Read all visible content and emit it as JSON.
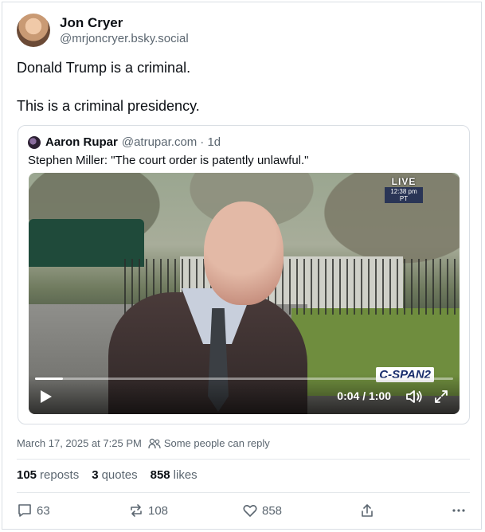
{
  "author": {
    "display_name": "Jon Cryer",
    "handle": "@mrjoncryer.bsky.social"
  },
  "post": {
    "lines": [
      "Donald Trump is a criminal.",
      "This is a criminal presidency."
    ]
  },
  "quoted_post": {
    "author_name": "Aaron Rupar",
    "author_handle": "@atrupar.com",
    "age": "· 1d",
    "text": "Stephen Miller: \"The court order is patently unlawful.\"",
    "video": {
      "live_label": "LIVE",
      "live_time": "12:38 pm PT",
      "network_logo": "C-SPAN2",
      "time_display": "0:04 / 1:00",
      "progress": 0.067,
      "icons": [
        "play-icon",
        "volume-icon",
        "fullscreen-icon"
      ]
    }
  },
  "meta": {
    "timestamp": "March 17, 2025 at 7:25 PM",
    "reply_setting": "Some people can reply"
  },
  "stats": [
    {
      "count": "105",
      "label": "reposts"
    },
    {
      "count": "3",
      "label": "quotes"
    },
    {
      "count": "858",
      "label": "likes"
    }
  ],
  "actions": {
    "reply_count": "63",
    "repost_count": "108",
    "like_count": "858"
  },
  "colors": {
    "muted_text": "#5b6670",
    "border": "#d9dee4"
  }
}
